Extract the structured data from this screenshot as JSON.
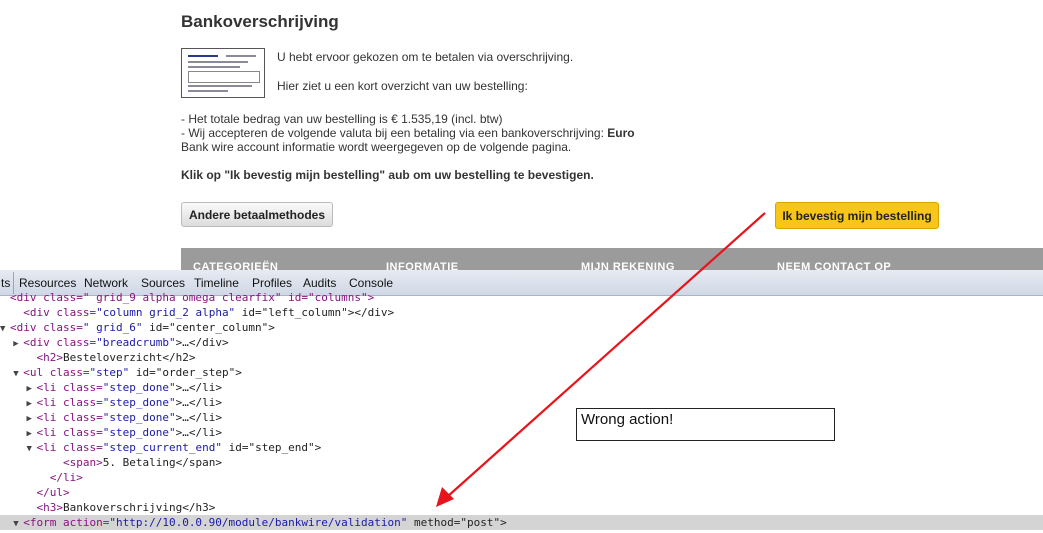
{
  "page": {
    "heading": "Bankoverschrijving",
    "intro": "U hebt ervoor gekozen om te betalen via overschrijving.",
    "summary_intro": "Hier ziet u een kort overzicht van uw bestelling:",
    "total_line": "- Het totale bedrag van uw bestelling is € 1.535,19 (incl. btw)",
    "currency_line_prefix": "- Wij accepteren de volgende valuta bij een betaling via een bankoverschrijving: ",
    "currency": "Euro",
    "bank_info": "Bank wire account informatie wordt weergegeven op de volgende pagina.",
    "confirm_instruction": "Klik op \"Ik bevestig mijn bestelling\" aub om uw bestelling te bevestigen.",
    "other_methods_button": "Andere betaalmethodes",
    "confirm_button": "Ik bevestig mijn bestelling",
    "footer_columns": [
      "CATEGORIEËN",
      "INFORMATIE",
      "MIJN REKENING",
      "NEEM CONTACT OP"
    ]
  },
  "devtools": {
    "tabs": [
      "ts",
      "Resources",
      "Network",
      "Sources",
      "Timeline",
      "Profiles",
      "Audits",
      "Console"
    ],
    "lines": [
      {
        "indent": "",
        "tri": "",
        "tag": "<div class=\" grid_9 alpha omega clearfix\" id=\"columns\">",
        "a": "",
        "v": "",
        "rest": ""
      },
      {
        "indent": "  ",
        "tri": "",
        "tag": "<div class=",
        "a": "",
        "v": "\"column grid_2 alpha\"",
        "rest": " id=\"left_column\"></div>"
      },
      {
        "indent": "",
        "tri": "▼",
        "tag": "<div class=",
        "a": "",
        "v": "\" grid_6\"",
        "rest": " id=\"center_column\">"
      },
      {
        "indent": "  ",
        "tri": "▶",
        "tag": "<div class=",
        "a": "",
        "v": "\"breadcrumb\"",
        "rest": ">…</div>"
      },
      {
        "indent": "    ",
        "tri": "",
        "tag": "<h2>",
        "a": "",
        "v": "",
        "rest": "Besteloverzicht</h2>"
      },
      {
        "indent": "  ",
        "tri": "▼",
        "tag": "<ul class=",
        "a": "",
        "v": "\"step\"",
        "rest": " id=\"order_step\">"
      },
      {
        "indent": "    ",
        "tri": "▶",
        "tag": "<li class=",
        "a": "",
        "v": "\"step_done\"",
        "rest": ">…</li>"
      },
      {
        "indent": "    ",
        "tri": "▶",
        "tag": "<li class=",
        "a": "",
        "v": "\"step_done\"",
        "rest": ">…</li>"
      },
      {
        "indent": "    ",
        "tri": "▶",
        "tag": "<li class=",
        "a": "",
        "v": "\"step_done\"",
        "rest": ">…</li>"
      },
      {
        "indent": "    ",
        "tri": "▶",
        "tag": "<li class=",
        "a": "",
        "v": "\"step_done\"",
        "rest": ">…</li>"
      },
      {
        "indent": "    ",
        "tri": "▼",
        "tag": "<li class=",
        "a": "",
        "v": "\"step_current_end\"",
        "rest": " id=\"step_end\">"
      },
      {
        "indent": "        ",
        "tri": "",
        "tag": "<span>",
        "a": "",
        "v": "",
        "rest": "5. Betaling</span>"
      },
      {
        "indent": "      ",
        "tri": "",
        "tag": "</li>",
        "a": "",
        "v": "",
        "rest": ""
      },
      {
        "indent": "    ",
        "tri": "",
        "tag": "</ul>",
        "a": "",
        "v": "",
        "rest": ""
      },
      {
        "indent": "    ",
        "tri": "",
        "tag": "<h3>",
        "a": "",
        "v": "",
        "rest": "Bankoverschrijving</h3>"
      },
      {
        "indent": "  ",
        "tri": "▼",
        "tag": "<form action=",
        "a": "",
        "v": "\"http://10.0.0.90/module/bankwire/validation\"",
        "rest": " method=\"post\">"
      }
    ]
  },
  "annotation": {
    "note": "Wrong action!",
    "arrow_color": "#e8141b"
  },
  "colors": {
    "confirm_button": "#f8c61b",
    "footer_bar": "#9b9b9b",
    "selected_line": "#d4d4d4"
  }
}
